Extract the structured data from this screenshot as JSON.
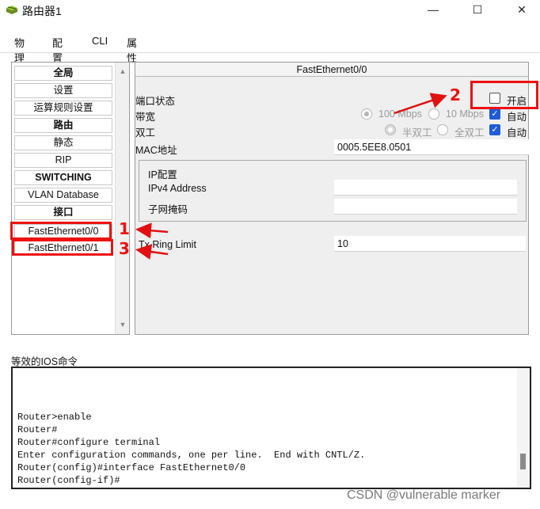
{
  "window": {
    "title": "路由器1",
    "min_symbol": "—",
    "max_symbol": "☐",
    "close_symbol": "✕"
  },
  "tabs": [
    {
      "label": "物理"
    },
    {
      "label": "配置"
    },
    {
      "label": "CLI"
    },
    {
      "label": "属性"
    }
  ],
  "nav": {
    "items": [
      {
        "label": "全局",
        "bold": true
      },
      {
        "label": "设置",
        "bold": false
      },
      {
        "label": "运算规则设置",
        "bold": false
      },
      {
        "label": "路由",
        "bold": true
      },
      {
        "label": "静态",
        "bold": false
      },
      {
        "label": "RIP",
        "bold": false
      },
      {
        "label": "SWITCHING",
        "bold": true
      },
      {
        "label": "VLAN Database",
        "bold": false
      },
      {
        "label": "接口",
        "bold": true
      },
      {
        "label": "FastEthernet0/0",
        "bold": false
      },
      {
        "label": "FastEthernet0/1",
        "bold": false
      }
    ]
  },
  "annotations": {
    "n1": "1",
    "n2": "2",
    "n3": "3"
  },
  "detail": {
    "header": "FastEthernet0/0",
    "port_status_label": "端口状态",
    "on_label": "开启",
    "bandwidth_label": "带宽",
    "bw_100": "100 Mbps",
    "bw_10": "10 Mbps",
    "auto_label": "自动",
    "duplex_label": "双工",
    "half_duplex": "半双工",
    "full_duplex": "全双工",
    "mac_label": "MAC地址",
    "mac_value": "0005.5EE8.0501",
    "ip_config_label": "IP配置",
    "ipv4_label": "IPv4 Address",
    "ipv4_value": "",
    "subnet_label": "子网掩码",
    "subnet_value": "",
    "tx_label": "Tx Ring Limit",
    "tx_value": "10"
  },
  "console": {
    "label": "等效的IOS命令",
    "lines": [
      "",
      "",
      "Router>enable",
      "Router#",
      "Router#configure terminal",
      "Enter configuration commands, one per line.  End with CNTL/Z.",
      "Router(config)#interface FastEthernet0/0",
      "Router(config-if)#"
    ]
  },
  "watermark": "CSDN @vulnerable marker",
  "colors": {
    "annotation": "#e11111",
    "checkbox_checked": "#1f5bd6"
  }
}
